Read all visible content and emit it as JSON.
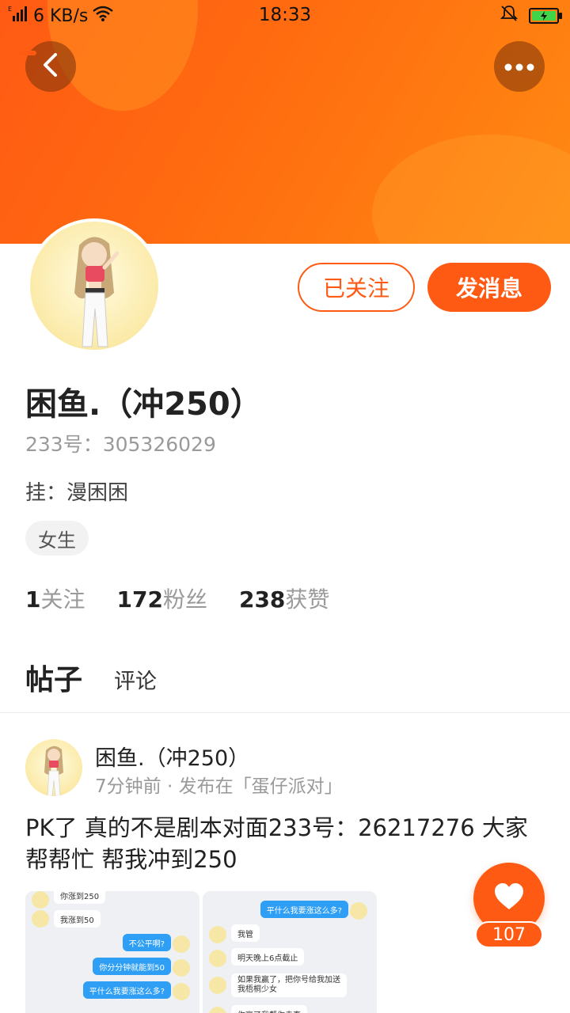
{
  "status_bar": {
    "network_speed": "6 KB/s",
    "time": "18:33",
    "signal_label": "E",
    "icons": [
      "signal-icon",
      "wifi-icon",
      "mute-icon",
      "battery-icon"
    ]
  },
  "header": {
    "colors": {
      "accent": "#ff5a14",
      "gradient_end": "#ff8a12"
    },
    "back_icon": "chevron-left-icon",
    "more_icon": "more-dots-icon"
  },
  "profile": {
    "follow_label": "已关注",
    "message_label": "发消息",
    "username": "困鱼.（冲250）",
    "uid": "233号：305326029",
    "bio": "挂：漫困困",
    "gender": "女生",
    "stats": [
      {
        "num": "1",
        "label": "关注"
      },
      {
        "num": "172",
        "label": "粉丝"
      },
      {
        "num": "238",
        "label": "获赞"
      }
    ]
  },
  "tabs": [
    {
      "label": "帖子",
      "active": true
    },
    {
      "label": "评论",
      "active": false
    }
  ],
  "post": {
    "author": "困鱼.（冲250）",
    "meta": "7分钟前 · 发布在「蛋仔派对」",
    "text": "PK了  真的不是剧本对面233号：26217276  大家帮帮忙  帮我冲到250",
    "images": {
      "left": [
        {
          "side": "other",
          "text": "你涨到250"
        },
        {
          "side": "other",
          "text": "我涨到50"
        },
        {
          "side": "me",
          "text": "不公平啊?"
        },
        {
          "side": "me",
          "text": "你分分钟就能到50"
        },
        {
          "side": "me",
          "text": "平什么我要涨这么多?"
        }
      ],
      "right": [
        {
          "side": "me",
          "text": "平什么我要涨这么多?"
        },
        {
          "side": "other",
          "text": "我管"
        },
        {
          "side": "other",
          "text": "明天晚上6点截止"
        },
        {
          "side": "other",
          "text": "如果我赢了，把你号给我加送我梧桐少女"
        },
        {
          "side": "other",
          "text": "你赢了我帮你走直"
        }
      ]
    },
    "like_count": "107",
    "like_icon": "heart-icon"
  }
}
